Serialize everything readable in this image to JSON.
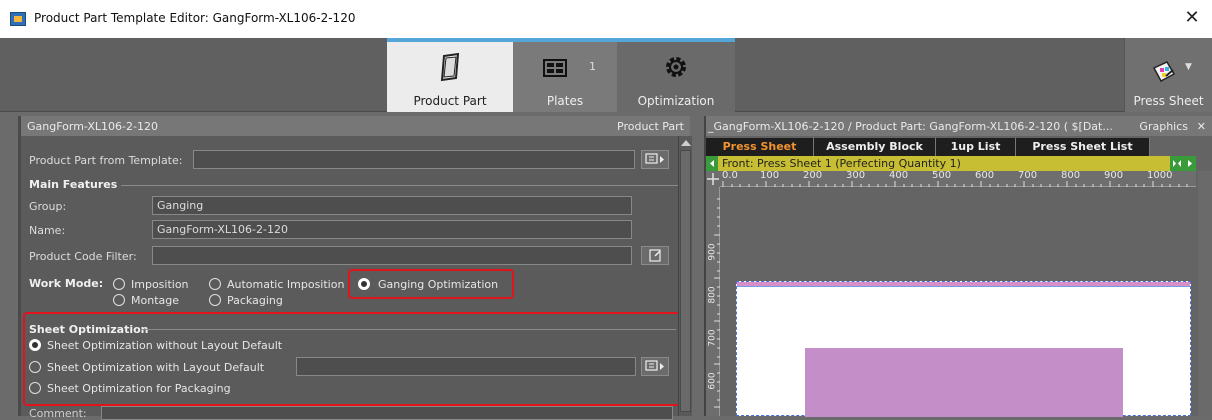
{
  "window": {
    "title": "Product Part Template Editor: GangForm-XL106-2-120",
    "close_glyph": "✕"
  },
  "workflow": {
    "steps": [
      {
        "label": "Product Part",
        "count": ""
      },
      {
        "label": "Plates",
        "count": "1"
      },
      {
        "label": "Optimization",
        "count": ""
      }
    ],
    "press_sheet_label": "Press Sheet",
    "press_sheet_dropdown": "▼"
  },
  "left_panel": {
    "header_title": "GangForm-XL106-2-120",
    "header_right": "Product Part",
    "template_label": "Product Part from Template:",
    "template_value": "",
    "main_features_title": "Main Features",
    "group_label": "Group:",
    "group_value": "Ganging",
    "name_label": "Name:",
    "name_value": "GangForm-XL106-2-120",
    "code_filter_label": "Product Code Filter:",
    "code_filter_value": "",
    "work_mode_label": "Work Mode:",
    "work_modes": [
      "Imposition",
      "Automatic Imposition",
      "Ganging Optimization",
      "Montage",
      "Packaging"
    ],
    "work_mode_selected": "Ganging Optimization",
    "sheet_opt_title": "Sheet Optimization",
    "sheet_options": [
      "Sheet Optimization without Layout Default",
      "Sheet Optimization with Layout Default",
      "Sheet Optimization for Packaging"
    ],
    "sheet_option_selected": "Sheet Optimization without Layout Default",
    "layout_default_value": "",
    "comment_label": "Comment:"
  },
  "right_panel": {
    "header_title": "_GangForm-XL106-2-120 / Product Part: GangForm-XL106-2-120 ( $[Dat...",
    "header_right": "Graphics",
    "close_glyph": "✕",
    "tabs": [
      "Press Sheet",
      "Assembly Block",
      "1up List",
      "Press Sheet List"
    ],
    "active_tab": "Press Sheet",
    "sheet_info": "Front: Press Sheet 1 (Perfecting Quantity 1)",
    "ruler_h": [
      "0.0",
      "100",
      "200",
      "300",
      "400",
      "500",
      "600",
      "700",
      "800",
      "900",
      "1000"
    ],
    "ruler_v": [
      "900",
      "800",
      "700",
      "600"
    ]
  },
  "colors": {
    "highlight_red": "#e0141c",
    "active_tab_orange": "#f2922e",
    "step_accent": "#55a6d8",
    "sheet_info_bar": "#c7be33"
  }
}
